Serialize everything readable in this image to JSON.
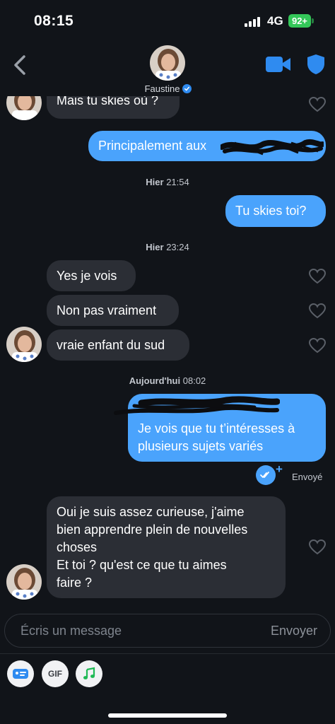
{
  "status_bar": {
    "time": "08:15",
    "network": "4G",
    "battery": "92+"
  },
  "header": {
    "contact_name": "Faustine"
  },
  "messages": [
    {
      "text": "Mais tu skies où ?"
    },
    {
      "text": "Principalement aux"
    },
    {
      "text": "Tu skies toi?"
    },
    {
      "text": "Yes je vois"
    },
    {
      "text": "Non pas vraiment"
    },
    {
      "text": "vraie enfant du sud"
    },
    {
      "lines": [
        "Je vois que tu t’intéresses à",
        "plusieurs sujets variés"
      ]
    },
    {
      "lines": [
        "Oui je suis assez curieuse, j'aime",
        "bien apprendre plein de nouvelles",
        "choses",
        "Et toi ? qu'est ce que tu aimes",
        "faire ?"
      ]
    }
  ],
  "timestamps": [
    {
      "day": "Hier",
      "time": "21:54"
    },
    {
      "day": "Hier",
      "time": "23:24"
    },
    {
      "day": "Aujourd'hui",
      "time": "08:02"
    }
  ],
  "sent_status": "Envoyé",
  "composer": {
    "placeholder": "Écris un message",
    "send_label": "Envoyer"
  },
  "toolbar": {
    "gif_label": "GIF"
  },
  "colors": {
    "outgoing_bubble": "#4aa3fc",
    "incoming_bubble": "#2b2e35",
    "background": "#111419",
    "battery": "#34c759"
  }
}
